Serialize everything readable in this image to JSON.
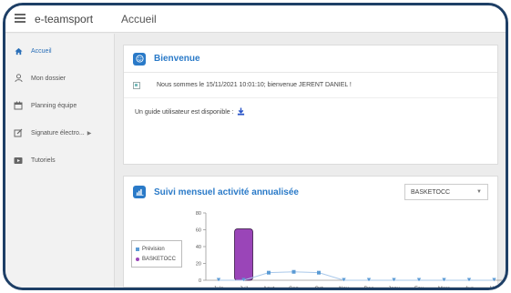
{
  "app": {
    "brand": "e-teamsport",
    "page_title": "Accueil"
  },
  "sidebar": {
    "items": [
      {
        "label": "Accueil",
        "icon": "home-icon",
        "active": true
      },
      {
        "label": "Mon dossier",
        "icon": "user-icon"
      },
      {
        "label": "Planning équipe",
        "icon": "calendar-icon"
      },
      {
        "label": "Signature électro...",
        "icon": "edit-icon",
        "has_submenu": true
      },
      {
        "label": "Tutoriels",
        "icon": "video-icon"
      }
    ]
  },
  "welcome": {
    "title": "Bienvenue",
    "message": "Nous sommes le 15/11/2021 10:01:10; bienvenue JERENT DANIEL !",
    "guide_text": "Un guide utilisateur est disponible :"
  },
  "activity": {
    "title": "Suivi mensuel activité annualisée",
    "select_value": "BASKETOCC"
  },
  "colors": {
    "accent": "#2a7ac8",
    "prevision": "#5b9bd5",
    "basketocc": "#9a45b8"
  },
  "chart_data": {
    "type": "bar",
    "categories": [
      "Juin",
      "Juil",
      "Aout",
      "Sep",
      "Oct",
      "Nov",
      "Dec",
      "Janv",
      "Fev",
      "Mars",
      "Avr",
      "Mai"
    ],
    "ylim": [
      0,
      80
    ],
    "yticks": [
      "0",
      "20",
      "40",
      "60",
      "80"
    ],
    "legend_position": "left",
    "series": [
      {
        "name": "Prévision",
        "type": "line",
        "values": [
          0,
          0,
          9,
          10,
          9,
          0,
          0,
          0,
          0,
          0,
          0,
          0
        ]
      },
      {
        "name": "BASKETOCC",
        "type": "bar",
        "values": [
          null,
          61,
          null,
          null,
          null,
          null,
          null,
          null,
          null,
          null,
          null,
          null
        ]
      }
    ]
  }
}
